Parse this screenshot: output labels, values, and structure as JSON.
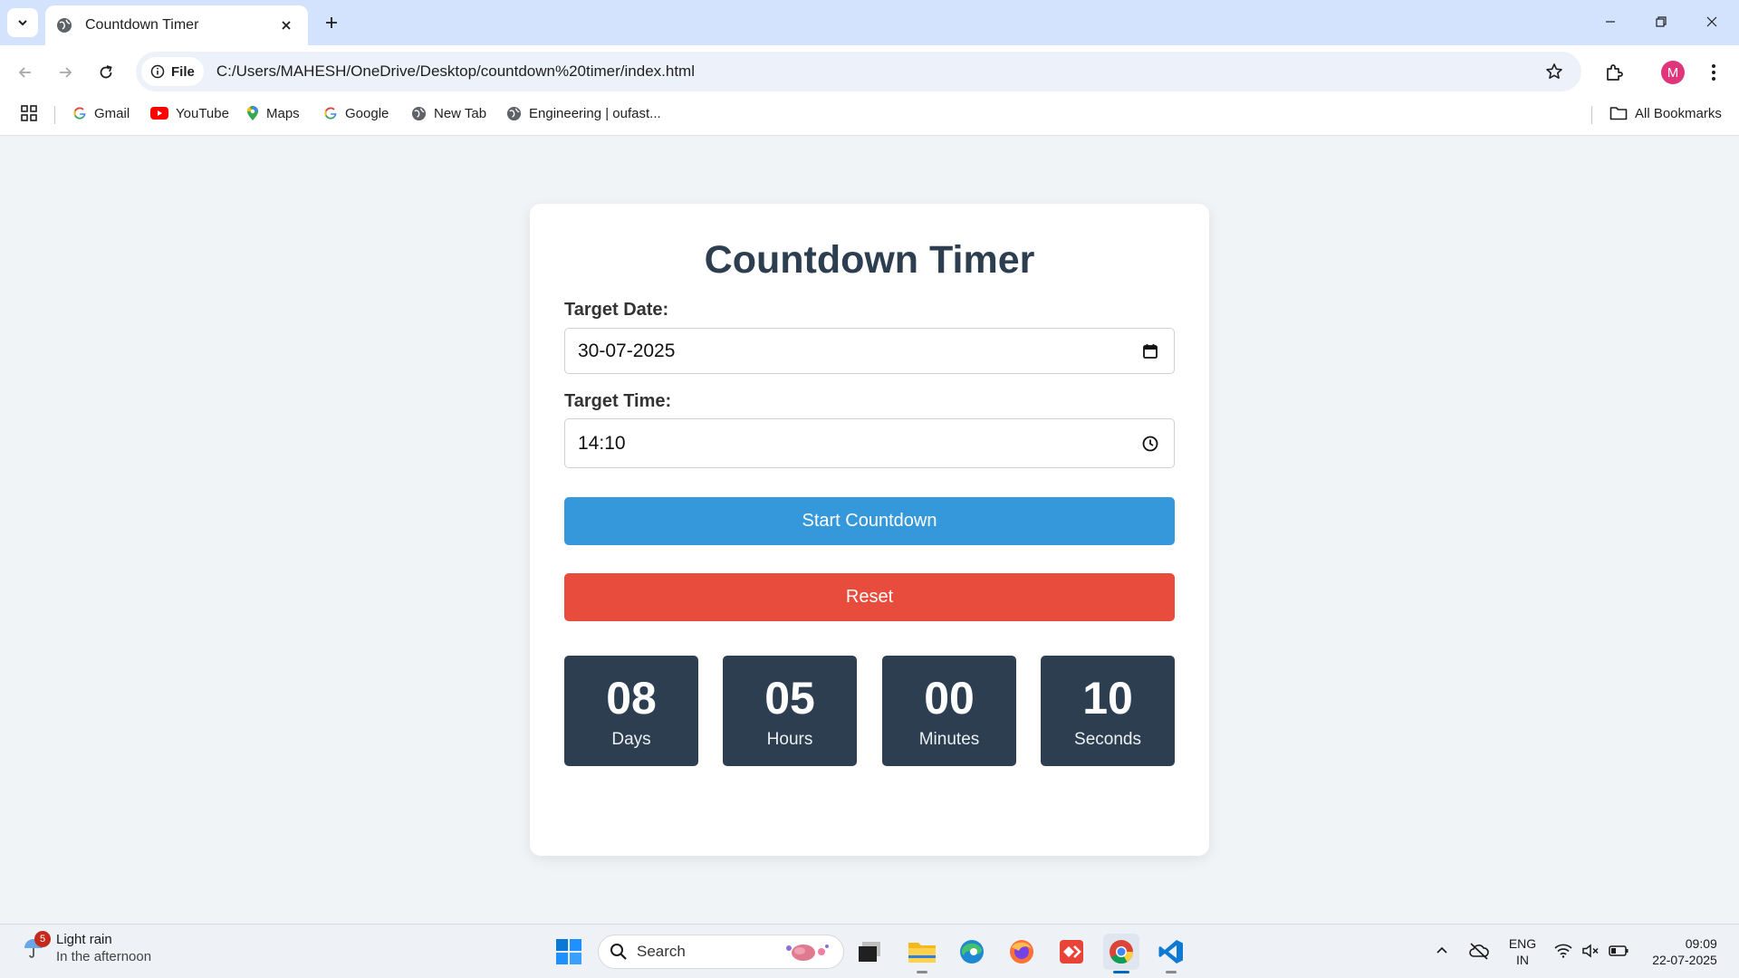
{
  "browser": {
    "tab_title": "Countdown Timer",
    "site_chip": "File",
    "url": "C:/Users/MAHESH/OneDrive/Desktop/countdown%20timer/index.html",
    "profile_initial": "M",
    "bookmarks": [
      {
        "label": "Gmail",
        "icon": "google-icon"
      },
      {
        "label": "YouTube",
        "icon": "youtube-icon"
      },
      {
        "label": "Maps",
        "icon": "maps-icon"
      },
      {
        "label": "Google",
        "icon": "google-icon"
      },
      {
        "label": "New Tab",
        "icon": "globe-icon"
      },
      {
        "label": "Engineering | oufast...",
        "icon": "globe-icon"
      }
    ],
    "all_bookmarks": "All Bookmarks"
  },
  "app": {
    "title": "Countdown Timer",
    "date_label": "Target Date:",
    "date_value": "30-07-2025",
    "time_label": "Target Time:",
    "time_value": "14:10",
    "start_label": "Start Countdown",
    "reset_label": "Reset",
    "countdown": [
      {
        "value": "08",
        "unit": "Days"
      },
      {
        "value": "05",
        "unit": "Hours"
      },
      {
        "value": "00",
        "unit": "Minutes"
      },
      {
        "value": "10",
        "unit": "Seconds"
      }
    ],
    "colors": {
      "start": "#3498db",
      "reset": "#e74c3c",
      "box": "#2c3e50",
      "title": "#2c3e50"
    }
  },
  "taskbar": {
    "weather_badge": "5",
    "weather_main": "Light rain",
    "weather_sub": "In the afternoon",
    "search_placeholder": "Search",
    "lang_top": "ENG",
    "lang_bottom": "IN",
    "clock_time": "09:09",
    "clock_date": "22-07-2025"
  }
}
